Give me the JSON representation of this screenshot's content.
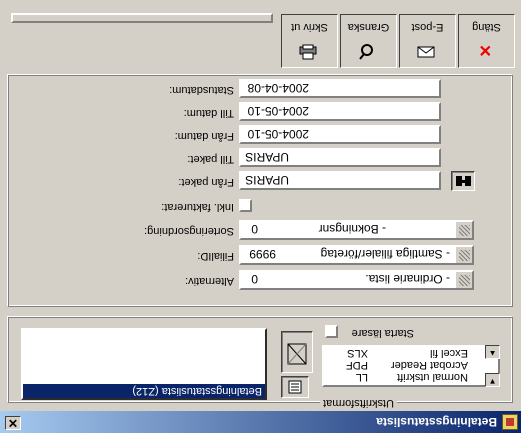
{
  "window": {
    "title": "Betalningsstatuslista"
  },
  "print_format": {
    "group_label": "Utskriftsformat",
    "list_selected": "Betalningsstatuslista (Z12)",
    "start_laser_label": "Starta läsare",
    "options": [
      "Normal utskrift",
      "Acrobat Reader",
      "Excel fil"
    ],
    "option_codes": [
      "LL",
      "PDF",
      "XLS"
    ]
  },
  "form": {
    "alternativ": {
      "label": "Alternativ:",
      "code": "0",
      "value": "- Ordinarie lista."
    },
    "filial_id": {
      "label": "FilialID:",
      "code": "9999",
      "value": "- Samtliga filialer/företag"
    },
    "sortering": {
      "label": "Sorteringsordning:",
      "code": "0",
      "value": "- Bokningsnr"
    },
    "inkl_fakt": {
      "label": "Inkl. fakturerat:"
    },
    "fran_paket": {
      "label": "Från paket:",
      "value": "UPARIS"
    },
    "till_paket": {
      "label": "Till paket:",
      "value": "UPARIS"
    },
    "fran_datum": {
      "label": "Från datum:",
      "value": "2004-05-10"
    },
    "till_datum": {
      "label": "Till datum:",
      "value": "2004-05-10"
    },
    "status_datum": {
      "label": "Statusdatum:",
      "value": "2004-04-08"
    }
  },
  "toolbar": {
    "buttons": [
      {
        "label": "Stäng",
        "icon": "close-icon"
      },
      {
        "label": "E-post",
        "icon": "email-icon"
      },
      {
        "label": "Granska",
        "icon": "preview-icon"
      },
      {
        "label": "Skriv ut",
        "icon": "printer-icon"
      }
    ]
  }
}
